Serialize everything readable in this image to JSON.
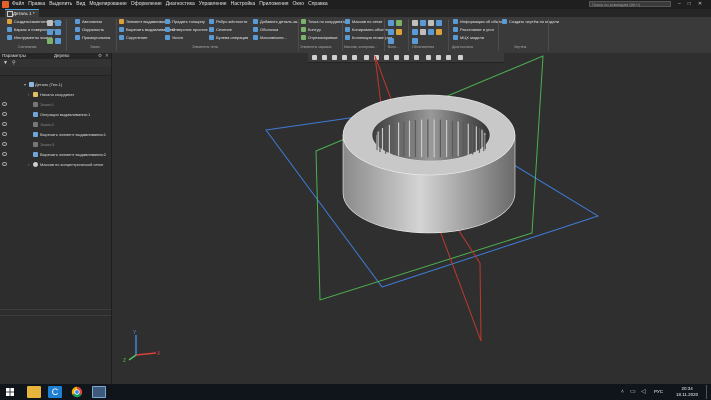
{
  "menubar": {
    "items": [
      "Файл",
      "Правка",
      "Выделить",
      "Вид",
      "Моделирование",
      "Оформление",
      "Диагностика",
      "Управление",
      "Настройка",
      "Приложения",
      "Окно",
      "Справка"
    ],
    "search_placeholder": "Поиск по командам (Alt+/)",
    "window_controls": [
      "–",
      "□",
      "✕"
    ]
  },
  "document_tab": {
    "label": "Деталь 1 *"
  },
  "ribbon": {
    "col1": [
      "Создать/изменить деталь",
      "Каркас и поверхности",
      "Инструменты эскиза"
    ],
    "col2": [
      "Автолинии",
      "Окружность",
      "Прямоугольник"
    ],
    "col3": [
      "Элемент выдавливания",
      "Вырезать выдавливанием",
      "Скругление"
    ],
    "col4": [
      "Придать толщину",
      "Отверстие простое",
      "Уклон"
    ],
    "col5": [
      "Ребро жёсткости",
      "Сечение",
      "Булева операция"
    ],
    "col6": [
      "Добавить деталь-за...",
      "Оболочка",
      "Массив/копи..."
    ],
    "col7": [
      "Точка по координатам",
      "Контур",
      "Отрезок/кривые"
    ],
    "col8": [
      "Массив по сетке",
      "Копировать объекты",
      "Коллекция геометрии"
    ],
    "col9": [
      "Информация об объекте",
      "Расстояние и угол",
      "МЦХ модели"
    ],
    "col10": [
      "Создать чертёж по модели"
    ],
    "groups": [
      "Системная",
      "Эскиз",
      "Элементы тела",
      "Элементы каркаса",
      "Массив, копирова...",
      "Вспо...",
      "Обозначения",
      "Диагностика",
      "Чертеж"
    ]
  },
  "left_panel": {
    "tabs": [
      "Параметры",
      "Дерево"
    ],
    "tree": [
      {
        "label": "Деталь (Тел-1)",
        "dim": false
      },
      {
        "label": "Начало координат",
        "dim": false
      },
      {
        "label": "Эскиз:1",
        "dim": true
      },
      {
        "label": "Операция выдавливания:1",
        "dim": false
      },
      {
        "label": "Эскиз:2",
        "dim": true
      },
      {
        "label": "Вырезать элемент выдавливания:1",
        "dim": false
      },
      {
        "label": "Эскиз:3",
        "dim": true
      },
      {
        "label": "Вырезать элемент выдавливания:2",
        "dim": false
      },
      {
        "label": "Массив по концентрической сетке",
        "dim": false
      }
    ]
  },
  "axes": {
    "x": "X",
    "y": "Y",
    "z": "Z"
  },
  "taskbar": {
    "apps": [
      "start",
      "file-explorer",
      "kompas",
      "chrome",
      "kompas-active"
    ],
    "lang": "РУС",
    "time": "20:34",
    "date": "18.11.2020"
  },
  "colors": {
    "menubar": "#1f1f1f",
    "ribbon": "#3a3a3a",
    "viewport": "#2f2f2f",
    "plane_blue": "#3d7bd6",
    "plane_green": "#4caf50",
    "plane_red": "#c0392b",
    "taskbar": "#10151c"
  }
}
